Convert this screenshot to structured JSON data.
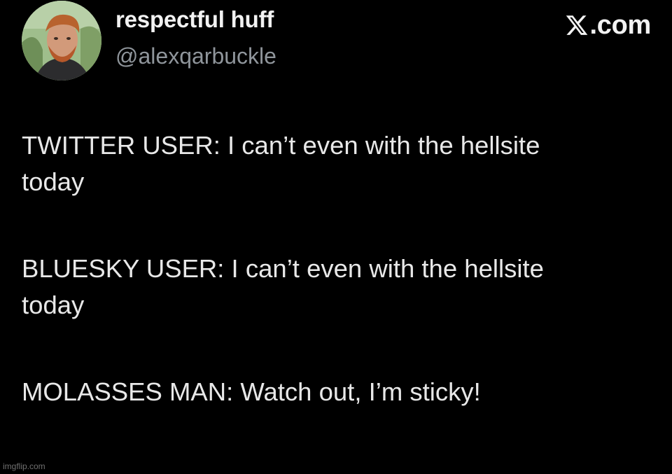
{
  "author": {
    "display_name": "respectful huff",
    "handle": "@alexqarbuckle"
  },
  "brand": {
    "label": "𝕏.com",
    "text": ".com",
    "icon": "x-logo-icon"
  },
  "tweet": {
    "lines": [
      "TWITTER USER: I can’t even with the hellsite",
      "today",
      "BLUESKY USER: I can’t even with the hellsite",
      "today",
      "MOLASSES MAN: Watch out, I’m sticky!"
    ]
  },
  "watermark": "imgflip.com",
  "colors": {
    "background": "#000000",
    "text": "#e8e8e8",
    "handle": "#8f959b",
    "name": "#f2f2f2"
  }
}
